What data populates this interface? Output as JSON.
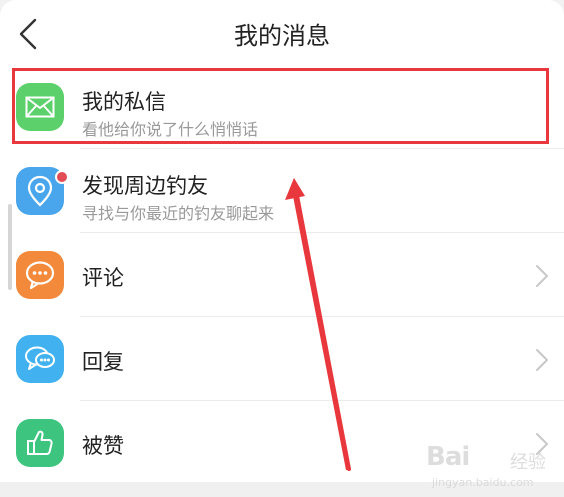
{
  "header": {
    "title": "我的消息",
    "back_icon": "chevron-left-icon"
  },
  "list": {
    "items": [
      {
        "title": "我的私信",
        "subtitle": "看他给你说了什么悄悄话",
        "icon": "mail-icon",
        "color": "#5cd06a",
        "badge": false,
        "chevron": false
      },
      {
        "title": "发现周边钓友",
        "subtitle": "寻找与你最近的钓友聊起来",
        "icon": "location-pin-icon",
        "color": "#4aa6ec",
        "badge": true,
        "badge_color": "#e34b55",
        "chevron": false
      },
      {
        "title": "评论",
        "subtitle": "",
        "icon": "comment-bubble-icon",
        "color": "#f38a3b",
        "badge": false,
        "chevron": true
      },
      {
        "title": "回复",
        "subtitle": "",
        "icon": "reply-bubbles-icon",
        "color": "#41b2ef",
        "badge": false,
        "chevron": true
      },
      {
        "title": "被赞",
        "subtitle": "",
        "icon": "thumbs-up-icon",
        "color": "#3dc47f",
        "badge": false,
        "chevron": true
      }
    ]
  },
  "annotation": {
    "box_color": "#e8383d",
    "arrow_color": "#e8383d"
  },
  "watermark": {
    "logo": "Bai",
    "text": "经验",
    "url": "jingyan.baidu.com"
  }
}
